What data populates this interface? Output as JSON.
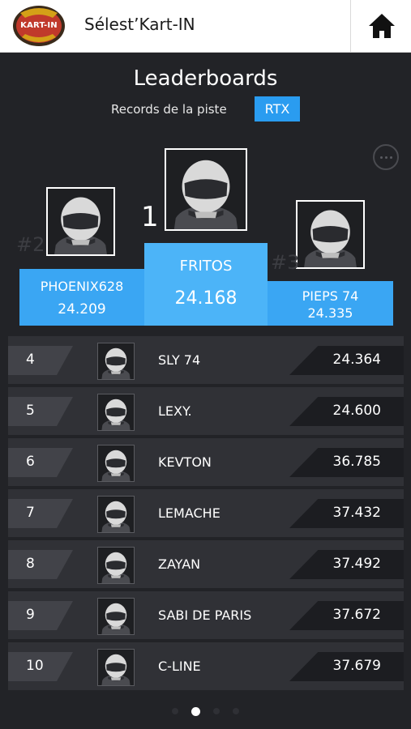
{
  "app": {
    "title": "Sélest’Kart-IN",
    "logo_text": "KART-IN",
    "home_icon": "home-icon"
  },
  "header": {
    "title": "Leaderboards",
    "subtitle": "Records de la piste",
    "track_badge": "RTX",
    "more_icon": "more-icon"
  },
  "podium": {
    "first": {
      "rank": "1",
      "name": "FRITOS",
      "time": "24.168"
    },
    "second": {
      "rank": "#2",
      "name": "PHOENIX628",
      "time": "24.209"
    },
    "third": {
      "rank": "#3",
      "name": "PIEPS 74",
      "time": "24.335"
    }
  },
  "rows": [
    {
      "rank": "4",
      "name": "SLY 74",
      "time": "24.364"
    },
    {
      "rank": "5",
      "name": "LEXY.",
      "time": "24.600"
    },
    {
      "rank": "6",
      "name": "KEVTON",
      "time": "36.785"
    },
    {
      "rank": "7",
      "name": "LEMACHE",
      "time": "37.432"
    },
    {
      "rank": "8",
      "name": "ZAYAN",
      "time": "37.492"
    },
    {
      "rank": "9",
      "name": "SABI DE PARIS",
      "time": "37.672"
    },
    {
      "rank": "10",
      "name": "C-LINE",
      "time": "37.679"
    }
  ],
  "pager": {
    "pages": 4,
    "active": 2
  },
  "colors": {
    "accent": "#2a9cf0",
    "podium_center": "#4cb4f8",
    "background": "#222327",
    "row": "#303136"
  }
}
